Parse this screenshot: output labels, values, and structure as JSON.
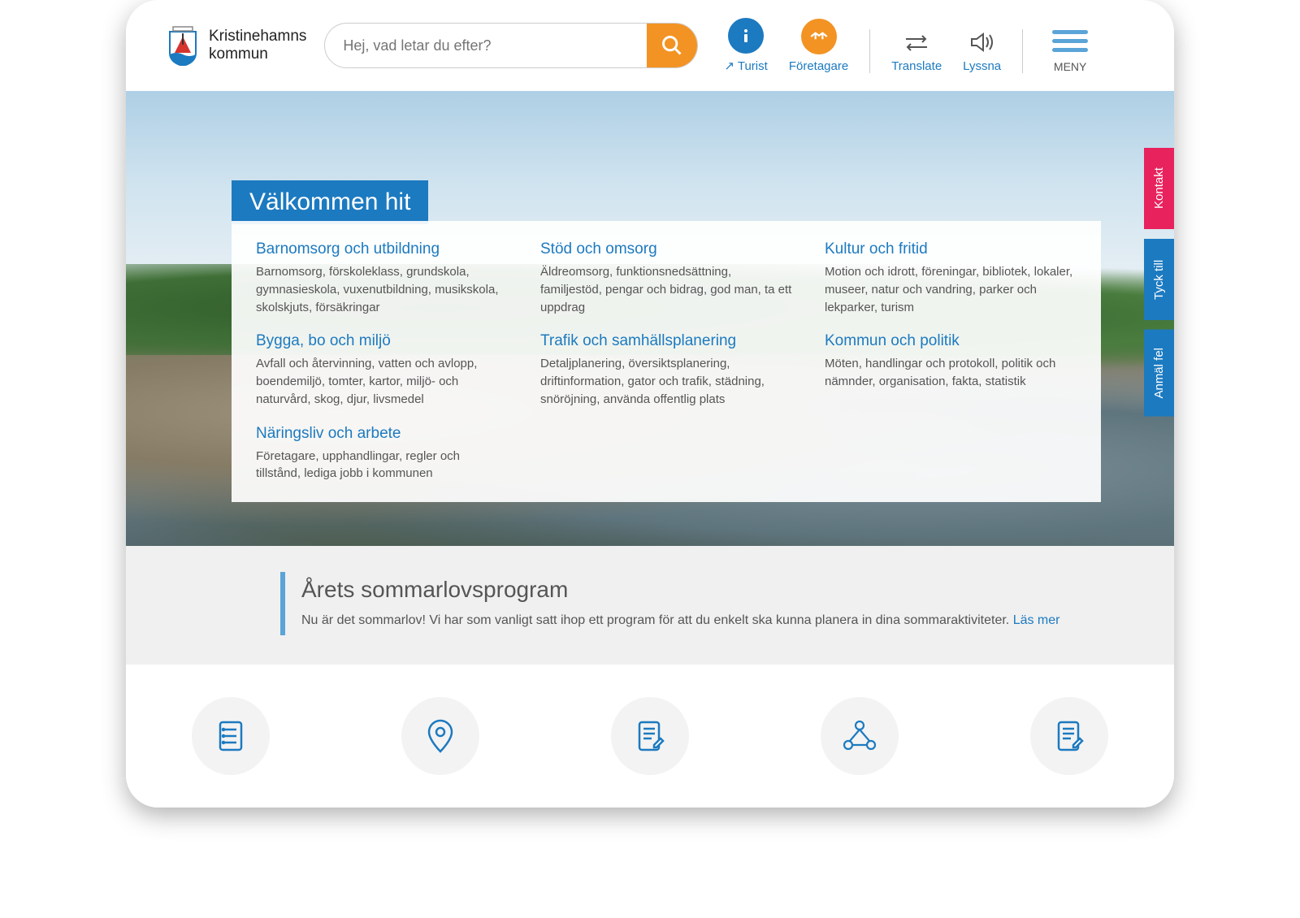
{
  "site": {
    "name_line1": "Kristinehamns",
    "name_line2": "kommun"
  },
  "search": {
    "placeholder": "Hej, vad letar du efter?"
  },
  "header": {
    "turist": "Turist",
    "foretagare": "Företagare",
    "translate": "Translate",
    "lyssna": "Lyssna",
    "meny": "MENY"
  },
  "hero": {
    "welcome": "Välkommen hit"
  },
  "categories": {
    "c1": {
      "title": "Barnomsorg och utbildning",
      "desc": "Barnomsorg, förskoleklass, grundskola, gymnasieskola, vuxenutbildning, musikskola, skolskjuts, försäkringar"
    },
    "c2": {
      "title": "Stöd och omsorg",
      "desc": "Äldreomsorg, funktionsnedsättning, familjestöd, pengar och bidrag, god man, ta ett uppdrag"
    },
    "c3": {
      "title": "Kultur och fritid",
      "desc": "Motion och idrott, föreningar, bibliotek, lokaler, museer, natur och vandring, parker och lekparker, turism"
    },
    "c4": {
      "title": "Bygga, bo och miljö",
      "desc": "Avfall och återvinning, vatten och avlopp, boendemiljö, tomter, kartor, miljö- och naturvård, skog, djur, livsmedel"
    },
    "c5": {
      "title": "Trafik och samhällsplanering",
      "desc": "Detaljplanering, översiktsplanering, driftinformation, gator och trafik, städning, snöröjning, använda offentlig plats"
    },
    "c6": {
      "title": "Kommun och politik",
      "desc": "Möten, handlingar och protokoll, politik och nämnder, organisation, fakta, statistik"
    },
    "c7": {
      "title": "Näringsliv och arbete",
      "desc": "Företagare, upphandlingar, regler och tillstånd, lediga jobb i kommunen"
    }
  },
  "side": {
    "kontakt": "Kontakt",
    "tyck": "Tyck till",
    "anmal": "Anmäl fel"
  },
  "promo": {
    "title": "Årets sommarlovsprogram",
    "body": "Nu är det sommarlov! Vi har som vanligt satt ihop ett program för att du enkelt ska kunna planera in dina sommaraktiviteter. ",
    "link": "Läs mer"
  }
}
